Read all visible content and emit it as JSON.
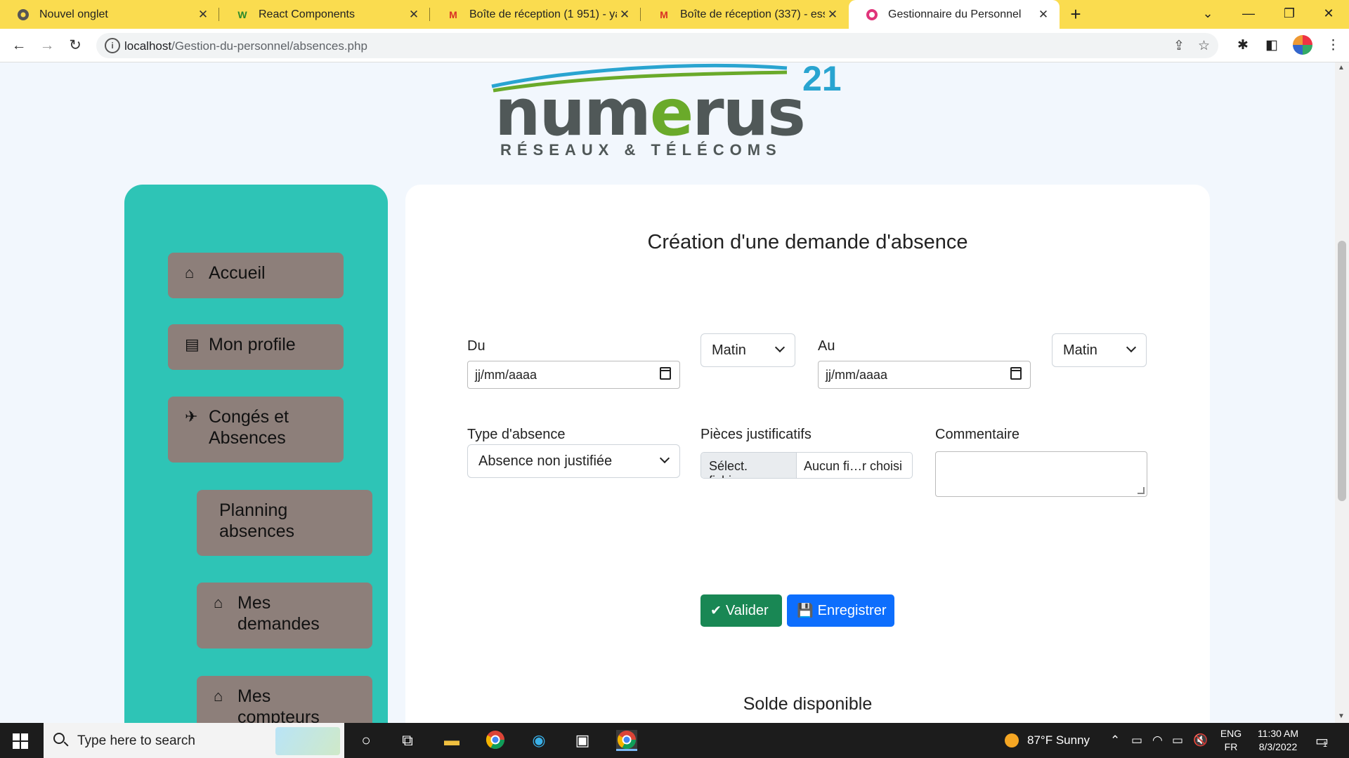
{
  "browser": {
    "tabs": [
      {
        "title": "Nouvel onglet",
        "icon": "chrome-icon"
      },
      {
        "title": "React Components",
        "icon": "w-icon"
      },
      {
        "title": "Boîte de réception (1 951) - yassi",
        "icon": "gmail-icon"
      },
      {
        "title": "Boîte de réception (337) - essada",
        "icon": "gmail-icon"
      },
      {
        "title": "Gestionnaire du Personnel",
        "icon": "app-icon"
      }
    ],
    "new_tab": "+",
    "url_host": "localhost",
    "url_path": "/Gestion-du-personnel/absences.php"
  },
  "logo": {
    "word": "numerus",
    "sup": "21",
    "subtitle": "RÉSEAUX & TÉLÉCOMS"
  },
  "sidebar": {
    "items": [
      {
        "label": "Accueil",
        "icon": "home-icon"
      },
      {
        "label": "Mon profile",
        "icon": "id-card-icon"
      },
      {
        "label": "Congés et Absences",
        "icon": "plane-icon"
      },
      {
        "label": "Planning absences",
        "icon": ""
      },
      {
        "label": "Mes demandes",
        "icon": "home-icon"
      },
      {
        "label": "Mes compteurs",
        "icon": "home-icon"
      }
    ]
  },
  "form": {
    "title": "Création d'une demande d'absence",
    "du_label": "Du",
    "du_value": "jj/mm/aaaa",
    "du_period": "Matin",
    "au_label": "Au",
    "au_value": "jj/mm/aaaa",
    "au_period": "Matin",
    "type_label": "Type d'absence",
    "type_value": "Absence non justifiée",
    "pieces_label": "Pièces justificatifs",
    "file_button": "Sélect. fichiers",
    "file_status": "Aucun fi…r choisi",
    "comment_label": "Commentaire",
    "comment_value": "",
    "valider_label": "Valider",
    "enregistrer_label": "Enregistrer",
    "solde_title": "Solde disponible",
    "solde_progress": 0
  },
  "taskbar": {
    "search_placeholder": "Type here to search",
    "weather": "87°F  Sunny",
    "lang_top": "ENG",
    "lang_bottom": "FR",
    "time": "11:30 AM",
    "date": "8/3/2022",
    "notif_count": "1"
  },
  "colors": {
    "tabstrip": "#fadc4f",
    "sidebar": "#2ec4b6",
    "nav_button": "#8d7f7a",
    "valider": "#198754",
    "enregistrer": "#0d6efd"
  }
}
